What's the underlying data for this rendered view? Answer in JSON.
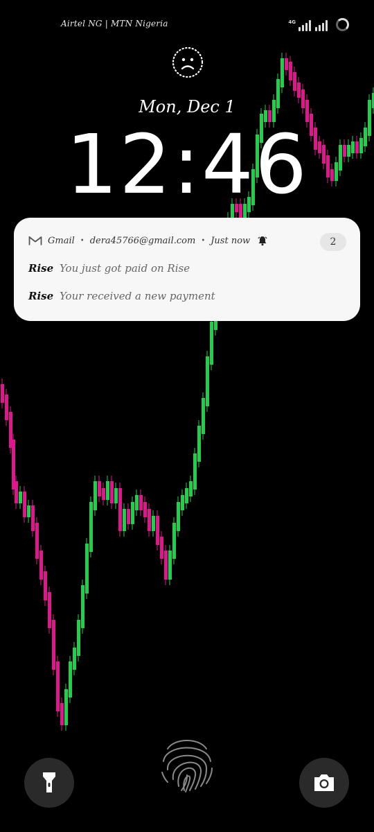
{
  "status_bar": {
    "carrier_text": "Airtel NG | MTN Nigeria",
    "network_type": "4G",
    "icons": [
      "signal-icon",
      "signal-icon",
      "battery-icon"
    ]
  },
  "lock_screen": {
    "lock_icon": "sad-face-lock-icon",
    "date": "Mon, Dec 1",
    "time": "12:46"
  },
  "notification": {
    "app_name": "Gmail",
    "account": "dera45766@gmail.com",
    "time": "Just now",
    "count": "2",
    "separator": "•",
    "items": [
      {
        "sender": "Rise",
        "message": "You just got paid on Rise"
      },
      {
        "sender": "Rise",
        "message": "Your received a new payment"
      }
    ]
  },
  "bottom": {
    "left_shortcut": "flashlight-icon",
    "center": "fingerprint-icon",
    "right_shortcut": "camera-icon"
  },
  "colors": {
    "background": "#000000",
    "bull_candle": "#1fd14a",
    "bear_candle": "#e0168f",
    "card": "#f7f7f7"
  }
}
